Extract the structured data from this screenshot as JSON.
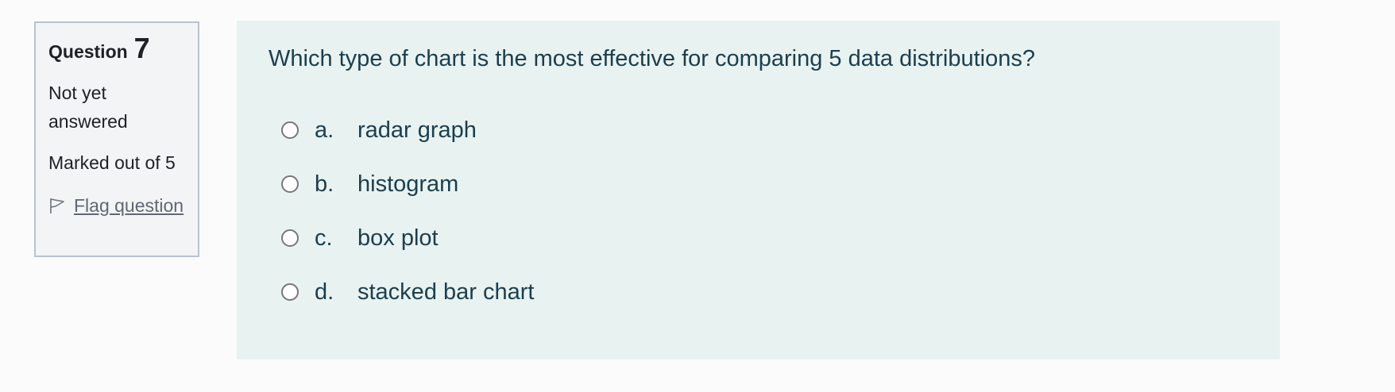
{
  "info": {
    "question_label": "Question",
    "question_number": "7",
    "state": "Not yet answered",
    "grade": "Marked out of 5",
    "flag_label": "Flag question"
  },
  "question": {
    "text": "Which type of chart is the most effective for comparing 5 data distributions?",
    "answers": [
      {
        "letter": "a.",
        "text": "radar graph",
        "selected": false
      },
      {
        "letter": "b.",
        "text": "histogram",
        "selected": false
      },
      {
        "letter": "c.",
        "text": "box plot",
        "selected": false
      },
      {
        "letter": "d.",
        "text": "stacked bar chart",
        "selected": false
      }
    ]
  },
  "icons": {
    "flag": "flag-icon",
    "radio": "radio-button"
  },
  "colors": {
    "info_background": "#f2f4f6",
    "info_border": "#b9c3cc",
    "content_background": "#e8f2f1",
    "question_text": "#1c3e4d",
    "link": "#5f6873"
  }
}
